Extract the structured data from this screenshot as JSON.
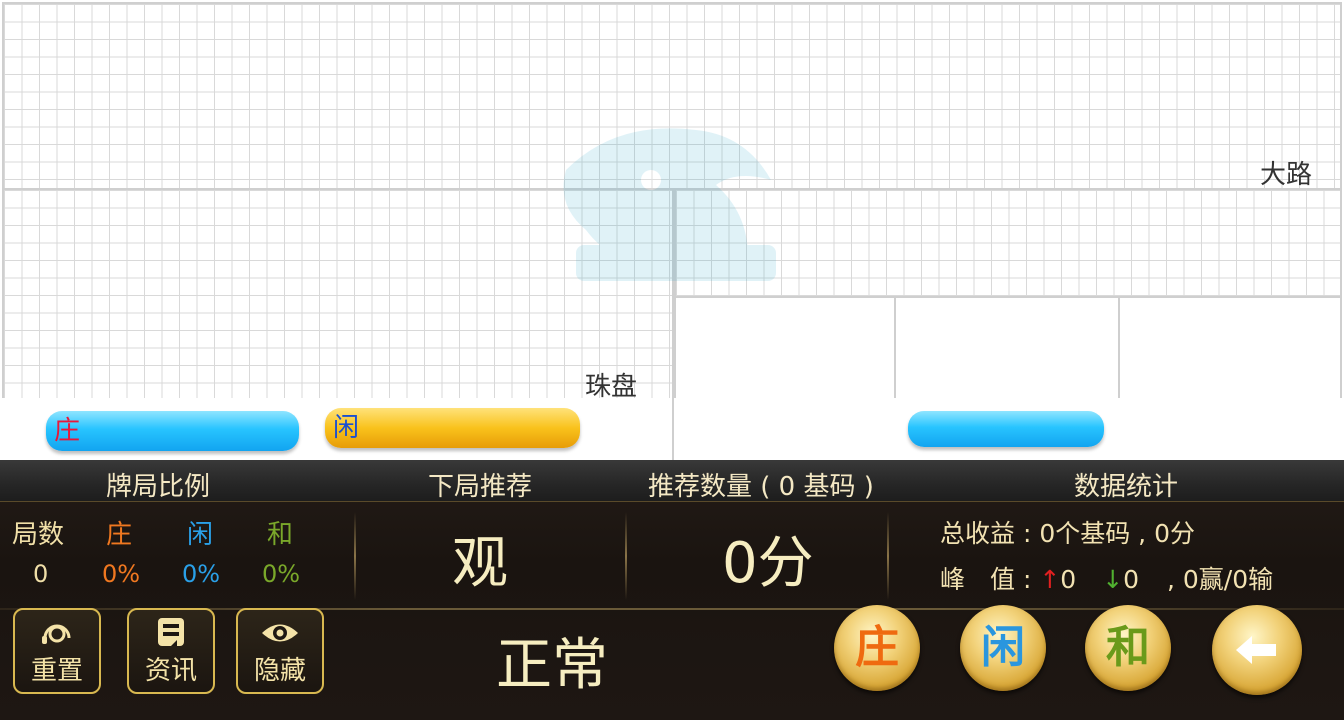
{
  "roads": {
    "big_road_label": "大路",
    "bead_plate_label": "珠盘"
  },
  "predictions": {
    "banker_label": "庄",
    "player_label": "闲"
  },
  "header": {
    "ratio": "牌局比例",
    "next": "下局推荐",
    "quantity": "推荐数量 ( 0 基码 )",
    "stats": "数据统计"
  },
  "ratio": {
    "columns": [
      "局数",
      "庄",
      "闲",
      "和"
    ],
    "values": [
      "0",
      "0%",
      "0%",
      "0%"
    ]
  },
  "recommendation": {
    "next": "观",
    "quantity": "0分",
    "status": "正常"
  },
  "stats": {
    "total_label": "总收益 : ",
    "total_value": "0个基码 , 0分",
    "peak_label": "峰　值 : ",
    "peak_up_arrow": "↑",
    "peak_up": "0",
    "peak_down_arrow": "↓",
    "peak_down": "0",
    "record": " , 0赢/0输"
  },
  "buttons": {
    "reset": "重置",
    "info": "资讯",
    "hide": "隐藏",
    "banker": "庄",
    "player": "闲",
    "tie": "和"
  },
  "icons": {
    "reset": "headset-icon",
    "info": "document-icon",
    "hide": "eye-icon",
    "back": "back-arrow-icon"
  },
  "colors": {
    "banker": "#f07820",
    "player": "#2aa0e8",
    "tie": "#7aa82a",
    "gold": "#d8b850"
  }
}
